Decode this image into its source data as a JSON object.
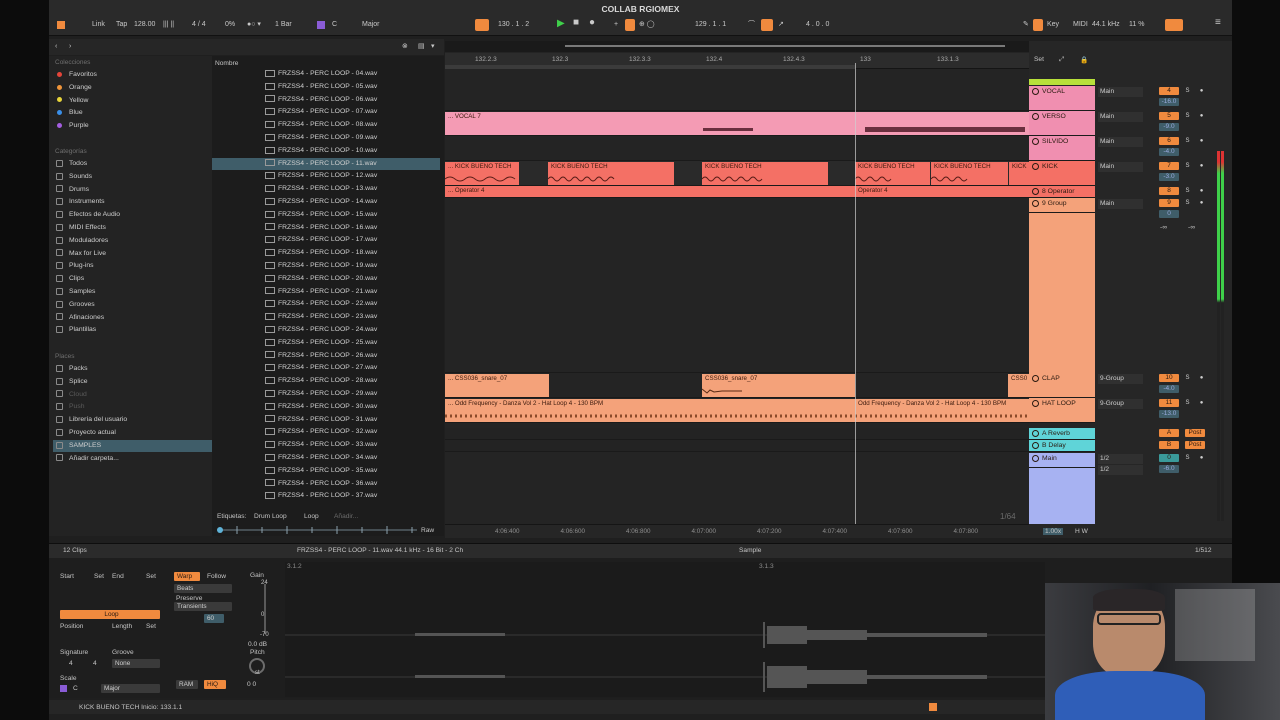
{
  "app": {
    "title": "COLLAB RGIOMEX"
  },
  "transport": {
    "link": "Link",
    "tap": "Tap",
    "tempo": "128.00",
    "signature": "4 / 4",
    "cpu_groove": "0%",
    "quantize": "1 Bar",
    "key": "C",
    "scale": "Major",
    "position": "130 .  1 .  2",
    "loop_start": "129 .  1 .  1",
    "loop_length": "4 .  0 .  0",
    "key_label": "Key",
    "midi_label": "MIDI",
    "sample_rate": "44.1 kHz",
    "cpu": "11 %"
  },
  "browser": {
    "collections_title": "Colecciones",
    "collections": [
      {
        "label": "Favoritos",
        "color": "#e5453a"
      },
      {
        "label": "Orange",
        "color": "#f0953a"
      },
      {
        "label": "Yellow",
        "color": "#e8d53a"
      },
      {
        "label": "Blue",
        "color": "#3a8fe8"
      },
      {
        "label": "Purple",
        "color": "#a45ee0"
      }
    ],
    "categories_title": "Categorías",
    "categories": [
      "Todos",
      "Sounds",
      "Drums",
      "Instruments",
      "Efectos de Audio",
      "MIDI Effects",
      "Moduladores",
      "Max for Live",
      "Plug-ins",
      "Clips",
      "Samples",
      "Grooves",
      "Afinaciones",
      "Plantillas"
    ],
    "places_title": "Places",
    "places": [
      "Packs",
      "Splice",
      "Cloud",
      "Push",
      "Librería del usuario",
      "Proyecto actual",
      "SAMPLES",
      "Añadir carpeta..."
    ],
    "column_header": "Nombre",
    "files": [
      "FRZSS4 - PERC LOOP - 04.wav",
      "FRZSS4 - PERC LOOP - 05.wav",
      "FRZSS4 - PERC LOOP - 06.wav",
      "FRZSS4 - PERC LOOP - 07.wav",
      "FRZSS4 - PERC LOOP - 08.wav",
      "FRZSS4 - PERC LOOP - 09.wav",
      "FRZSS4 - PERC LOOP - 10.wav",
      "FRZSS4 - PERC LOOP - 11.wav",
      "FRZSS4 - PERC LOOP - 12.wav",
      "FRZSS4 - PERC LOOP - 13.wav",
      "FRZSS4 - PERC LOOP - 14.wav",
      "FRZSS4 - PERC LOOP - 15.wav",
      "FRZSS4 - PERC LOOP - 16.wav",
      "FRZSS4 - PERC LOOP - 17.wav",
      "FRZSS4 - PERC LOOP - 18.wav",
      "FRZSS4 - PERC LOOP - 19.wav",
      "FRZSS4 - PERC LOOP - 20.wav",
      "FRZSS4 - PERC LOOP - 21.wav",
      "FRZSS4 - PERC LOOP - 22.wav",
      "FRZSS4 - PERC LOOP - 23.wav",
      "FRZSS4 - PERC LOOP - 24.wav",
      "FRZSS4 - PERC LOOP - 25.wav",
      "FRZSS4 - PERC LOOP - 26.wav",
      "FRZSS4 - PERC LOOP - 27.wav",
      "FRZSS4 - PERC LOOP - 28.wav",
      "FRZSS4 - PERC LOOP - 29.wav",
      "FRZSS4 - PERC LOOP - 30.wav",
      "FRZSS4 - PERC LOOP - 31.wav",
      "FRZSS4 - PERC LOOP - 32.wav",
      "FRZSS4 - PERC LOOP - 33.wav",
      "FRZSS4 - PERC LOOP - 34.wav",
      "FRZSS4 - PERC LOOP - 35.wav",
      "FRZSS4 - PERC LOOP - 36.wav",
      "FRZSS4 - PERC LOOP - 37.wav"
    ],
    "selected_file": "FRZSS4 - PERC LOOP - 11.wav",
    "tags_label": "Etiquetas:",
    "tags": [
      "Drum Loop",
      "Loop",
      "Añadir..."
    ],
    "raw_label": "Raw"
  },
  "arrangement": {
    "bar_labels": [
      "132.2.3",
      "132.3",
      "132.3.3",
      "132.4",
      "132.4.3",
      "133",
      "133.1.3"
    ],
    "time_labels": [
      "4:06:400",
      "4:06:600",
      "4:06:800",
      "4:07:000",
      "4:07:200",
      "4:07:400",
      "4:07:600",
      "4:07:800"
    ],
    "page_indicator": "1/64",
    "clips": {
      "vocal": "... VOCAL 7",
      "kick": "KICK BUENO TECH",
      "kick_start": "... KICK BUENO TECH",
      "kick_tail": "KICK",
      "operator": "... Operator 4",
      "operator2": "Operator 4",
      "snare": "... CSS036_snare_07",
      "snare2": "CSS036_snare_07",
      "snare_tail": "CSS0",
      "hat": "... Odd Frequency - Danza Vol 2 - Hat Loop 4 - 130 BPM",
      "hat2": "Odd Frequency - Danza Vol 2 - Hat Loop 4 - 130 BPM"
    }
  },
  "mixer": {
    "set_label": "Set",
    "tracks": [
      {
        "name": "VOCAL",
        "routing": "Main",
        "num": "4",
        "vol": "-16.0",
        "color": "#f08fb0"
      },
      {
        "name": "VERSO",
        "routing": "Main",
        "num": "5",
        "vol": "-9.0",
        "color": "#f08fb0"
      },
      {
        "name": "SILVIDO",
        "routing": "Main",
        "num": "6",
        "vol": "-4.0",
        "color": "#f08fb0"
      },
      {
        "name": "KICK",
        "routing": "Main",
        "num": "7",
        "vol": "-3.0",
        "color": "#f47065"
      },
      {
        "name": "8 Operator",
        "routing": "",
        "num": "8",
        "vol": "",
        "color": "#f47065"
      },
      {
        "name": "9 Group",
        "routing": "Main",
        "num": "9",
        "vol": "0",
        "color": "#f4a27a"
      },
      {
        "name": "CLAP",
        "routing": "9-Group",
        "num": "10",
        "vol": "-4.0",
        "color": "#f4a27a"
      },
      {
        "name": "HAT LOOP",
        "routing": "9-Group",
        "num": "11",
        "vol": "-13.0",
        "color": "#f4a27a"
      },
      {
        "name": "A Reverb",
        "routing": "",
        "num": "A",
        "vol": "",
        "color": "#5fd4d8"
      },
      {
        "name": "B Delay",
        "routing": "",
        "num": "B",
        "vol": "",
        "color": "#5fd4d8"
      },
      {
        "name": "Main",
        "routing": "1/2",
        "num": "0",
        "vol": "-6.0",
        "color": "#a7b2f2"
      }
    ],
    "group_extra": "-∞",
    "routing_extra": "1/2",
    "post_label": "Post",
    "zoom": "1.00x",
    "hw": "H   W"
  },
  "detail": {
    "clips_label": "12 Clips",
    "file_info": "FRZSS4 - PERC LOOP - 11.wav  44.1 kHz - 16 Bit - 2 Ch",
    "tab": "Sample",
    "page": "1/512",
    "start": "Start",
    "set": "Set",
    "end": "End",
    "warp": "Warp",
    "follow": "Follow",
    "beats": "Beats",
    "preserve": "Preserve",
    "transients": "Transients",
    "gain": "Gain",
    "gain_top": "24",
    "gain_zero": "0",
    "gain_bottom": "-70",
    "gain_db": "0.0 dB",
    "pitch": "Pitch",
    "st": "st",
    "loop": "Loop",
    "position": "Position",
    "length": "Length",
    "signature": "Signature",
    "groove": "Groove",
    "sig_num": "4",
    "sig_den": "4",
    "groove_val": "None",
    "scale": "Scale",
    "scale_key": "C",
    "scale_mode": "Major",
    "ram": "RAM",
    "hiq": "HiQ",
    "pitch_vals": "0   0",
    "marker_a": "3.1.2",
    "marker_b": "3.1.3",
    "transient_val": "60"
  },
  "status": {
    "text": "KICK BUENO TECH   Inicio: 133.1.1"
  }
}
